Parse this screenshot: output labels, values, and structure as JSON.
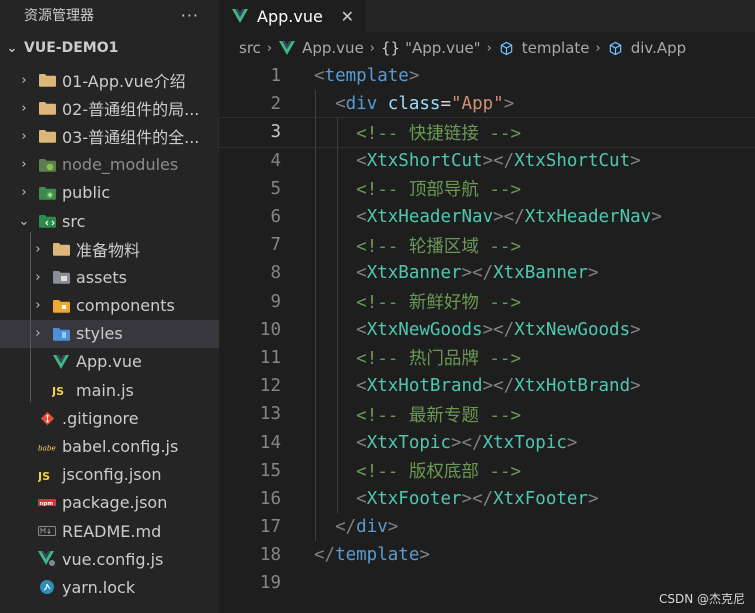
{
  "sidebar": {
    "title": "资源管理器",
    "more": "···",
    "project": "VUE-DEMO1",
    "items": [
      {
        "label": "01-App.vue介绍",
        "icon": "folder-icon",
        "chev": "›"
      },
      {
        "label": "02-普通组件的局...",
        "icon": "folder-icon",
        "chev": "›"
      },
      {
        "label": "03-普通组件的全...",
        "icon": "folder-icon",
        "chev": "›"
      },
      {
        "label": "node_modules",
        "icon": "node-modules-folder-icon",
        "chev": "›"
      },
      {
        "label": "public",
        "icon": "public-folder-icon",
        "chev": "›"
      },
      {
        "label": "src",
        "icon": "src-folder-icon",
        "chev": "⌄"
      },
      {
        "label": "准备物料",
        "icon": "folder-icon",
        "chev": "›"
      },
      {
        "label": "assets",
        "icon": "assets-folder-icon",
        "chev": "›"
      },
      {
        "label": "components",
        "icon": "components-folder-icon",
        "chev": "›"
      },
      {
        "label": "styles",
        "icon": "styles-folder-icon",
        "chev": "›"
      },
      {
        "label": "App.vue",
        "icon": "vue-file-icon"
      },
      {
        "label": "main.js",
        "icon": "js-file-icon"
      },
      {
        "label": ".gitignore",
        "icon": "git-file-icon"
      },
      {
        "label": "babel.config.js",
        "icon": "babel-file-icon"
      },
      {
        "label": "jsconfig.json",
        "icon": "js-file-icon"
      },
      {
        "label": "package.json",
        "icon": "npm-file-icon"
      },
      {
        "label": "README.md",
        "icon": "markdown-file-icon"
      },
      {
        "label": "vue.config.js",
        "icon": "vue-config-file-icon"
      },
      {
        "label": "yarn.lock",
        "icon": "yarn-file-icon"
      }
    ]
  },
  "tab": {
    "label": "App.vue",
    "close": "✕"
  },
  "breadcrumb": {
    "src": "src",
    "file": "App.vue",
    "braces": "{}",
    "module": "\"App.vue\"",
    "template": "template",
    "div": "div.App"
  },
  "editor": {
    "current_line": 3,
    "lines": [
      {
        "n": "1",
        "tokens": [
          [
            "punc",
            "<"
          ],
          [
            "tag",
            "template"
          ],
          [
            "punc",
            ">"
          ]
        ]
      },
      {
        "n": "2",
        "tokens": [
          [
            "txt",
            "  "
          ],
          [
            "punc",
            "<"
          ],
          [
            "tag",
            "div"
          ],
          [
            "txt",
            " "
          ],
          [
            "attr",
            "class"
          ],
          [
            "txt",
            "="
          ],
          [
            "str",
            "\"App\""
          ],
          [
            "punc",
            ">"
          ]
        ]
      },
      {
        "n": "3",
        "tokens": [
          [
            "txt",
            "    "
          ],
          [
            "com",
            "<!-- 快捷链接 -->"
          ]
        ]
      },
      {
        "n": "4",
        "tokens": [
          [
            "txt",
            "    "
          ],
          [
            "punc",
            "<"
          ],
          [
            "comp",
            "XtxShortCut"
          ],
          [
            "punc",
            "></"
          ],
          [
            "comp",
            "XtxShortCut"
          ],
          [
            "punc",
            ">"
          ]
        ]
      },
      {
        "n": "5",
        "tokens": [
          [
            "txt",
            "    "
          ],
          [
            "com",
            "<!-- 顶部导航 -->"
          ]
        ]
      },
      {
        "n": "6",
        "tokens": [
          [
            "txt",
            "    "
          ],
          [
            "punc",
            "<"
          ],
          [
            "comp",
            "XtxHeaderNav"
          ],
          [
            "punc",
            "></"
          ],
          [
            "comp",
            "XtxHeaderNav"
          ],
          [
            "punc",
            ">"
          ]
        ]
      },
      {
        "n": "7",
        "tokens": [
          [
            "txt",
            "    "
          ],
          [
            "com",
            "<!-- 轮播区域 -->"
          ]
        ]
      },
      {
        "n": "8",
        "tokens": [
          [
            "txt",
            "    "
          ],
          [
            "punc",
            "<"
          ],
          [
            "comp",
            "XtxBanner"
          ],
          [
            "punc",
            "></"
          ],
          [
            "comp",
            "XtxBanner"
          ],
          [
            "punc",
            ">"
          ]
        ]
      },
      {
        "n": "9",
        "tokens": [
          [
            "txt",
            "    "
          ],
          [
            "com",
            "<!-- 新鲜好物 -->"
          ]
        ]
      },
      {
        "n": "10",
        "tokens": [
          [
            "txt",
            "    "
          ],
          [
            "punc",
            "<"
          ],
          [
            "comp",
            "XtxNewGoods"
          ],
          [
            "punc",
            "></"
          ],
          [
            "comp",
            "XtxNewGoods"
          ],
          [
            "punc",
            ">"
          ]
        ]
      },
      {
        "n": "11",
        "tokens": [
          [
            "txt",
            "    "
          ],
          [
            "com",
            "<!-- 热门品牌 -->"
          ]
        ]
      },
      {
        "n": "12",
        "tokens": [
          [
            "txt",
            "    "
          ],
          [
            "punc",
            "<"
          ],
          [
            "comp",
            "XtxHotBrand"
          ],
          [
            "punc",
            "></"
          ],
          [
            "comp",
            "XtxHotBrand"
          ],
          [
            "punc",
            ">"
          ]
        ]
      },
      {
        "n": "13",
        "tokens": [
          [
            "txt",
            "    "
          ],
          [
            "com",
            "<!-- 最新专题 -->"
          ]
        ]
      },
      {
        "n": "14",
        "tokens": [
          [
            "txt",
            "    "
          ],
          [
            "punc",
            "<"
          ],
          [
            "comp",
            "XtxTopic"
          ],
          [
            "punc",
            "></"
          ],
          [
            "comp",
            "XtxTopic"
          ],
          [
            "punc",
            ">"
          ]
        ]
      },
      {
        "n": "15",
        "tokens": [
          [
            "txt",
            "    "
          ],
          [
            "com",
            "<!-- 版权底部 -->"
          ]
        ]
      },
      {
        "n": "16",
        "tokens": [
          [
            "txt",
            "    "
          ],
          [
            "punc",
            "<"
          ],
          [
            "comp",
            "XtxFooter"
          ],
          [
            "punc",
            "></"
          ],
          [
            "comp",
            "XtxFooter"
          ],
          [
            "punc",
            ">"
          ]
        ]
      },
      {
        "n": "17",
        "tokens": [
          [
            "txt",
            "  "
          ],
          [
            "punc",
            "</"
          ],
          [
            "tag",
            "div"
          ],
          [
            "punc",
            ">"
          ]
        ]
      },
      {
        "n": "18",
        "tokens": [
          [
            "punc",
            "</"
          ],
          [
            "tag",
            "template"
          ],
          [
            "punc",
            ">"
          ]
        ]
      },
      {
        "n": "19",
        "tokens": []
      }
    ]
  },
  "watermark": "CSDN @杰克尼",
  "colors": {
    "tag": "#569cd6",
    "component": "#4ec9b0",
    "attribute": "#9cdcfe",
    "string": "#ce9178",
    "comment": "#6a9955",
    "punctuation": "#808080",
    "vue_green": "#41b883",
    "folder": "#dcb67a"
  }
}
